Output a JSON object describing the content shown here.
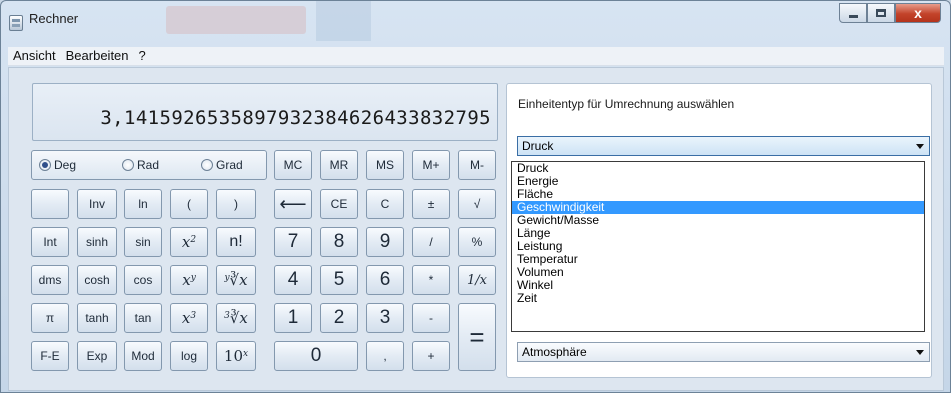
{
  "window": {
    "title": "Rechner",
    "controls": {
      "close_glyph": "x"
    }
  },
  "menu": [
    "Ansicht",
    "Bearbeiten",
    "?"
  ],
  "display": {
    "value": "3,14159265358979323846264338327 95"
  },
  "angle_modes": {
    "options": [
      "Deg",
      "Rad",
      "Grad"
    ],
    "selected": "Deg"
  },
  "memory_buttons": [
    "MC",
    "MR",
    "MS",
    "M+",
    "M-"
  ],
  "keypad": {
    "row1": [
      "",
      "Inv",
      "ln",
      "(",
      ")",
      "⟵",
      "CE",
      "C",
      "±",
      "√"
    ],
    "row2": [
      "Int",
      "sinh",
      "sin",
      "x",
      "n!",
      "7",
      "8",
      "9",
      "/",
      "%"
    ],
    "row3": [
      "dms",
      "cosh",
      "cos",
      "x",
      "∛x",
      "4",
      "5",
      "6",
      "*",
      "1/x"
    ],
    "row4": [
      "π",
      "tanh",
      "tan",
      "x",
      "∛x",
      "1",
      "2",
      "3",
      "-",
      "="
    ],
    "row5": [
      "F-E",
      "Exp",
      "Mod",
      "log",
      "10",
      "0",
      ",",
      "+"
    ],
    "superscripts": {
      "x2": "2",
      "xy": "y",
      "x3": "3",
      "10x": "x",
      "root_y": "y",
      "root_3": "3"
    }
  },
  "converter": {
    "label": "Einheitentyp für Umrechnung auswählen",
    "selected_type": "Druck",
    "types": [
      "Druck",
      "Energie",
      "Fläche",
      "Geschwindigkeit",
      "Gewicht/Masse",
      "Länge",
      "Leistung",
      "Temperatur",
      "Volumen",
      "Winkel",
      "Zeit"
    ],
    "highlighted": "Geschwindigkeit",
    "second_combo_value": "Atmosphäre"
  },
  "colors": {
    "highlight": "#3399ff",
    "close_button": "#c3432a"
  }
}
